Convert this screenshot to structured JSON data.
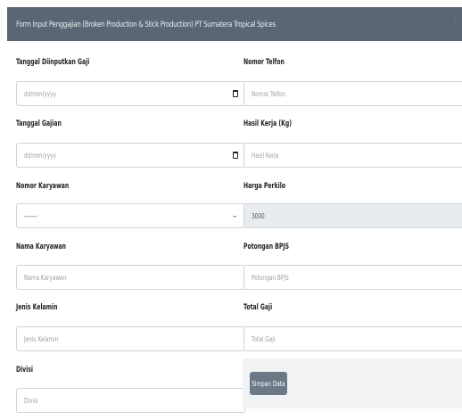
{
  "header": {
    "title": "Form Input Penggajian (Broken Production & Stick Production) PT Sumatera Tropical Spices",
    "tool_icon": "menu-icon"
  },
  "left": {
    "tanggal_diinputkan": {
      "label": "Tanggal Diinputkan Gaji",
      "placeholder": "dd/mm/yyyy"
    },
    "tanggal_gajian": {
      "label": "Tanggal Gajian",
      "placeholder": "dd/mm/yyyy"
    },
    "nomor_karyawan": {
      "label": "Nomor Karyawan",
      "value": "-------"
    },
    "nama_karyawan": {
      "label": "Nama Karyawan",
      "placeholder": "Nama Karyawan"
    },
    "jenis_kelamin": {
      "label": "Jenis Kelamin",
      "placeholder": "Jenis Kelamin"
    },
    "divisi": {
      "label": "Divisi",
      "placeholder": "Divisi"
    }
  },
  "right": {
    "nomor_telfon": {
      "label": "Nomor Telfon",
      "placeholder": "Nomor Telfon"
    },
    "hasil_kerja": {
      "label": "Hasil Kerja (Kg)",
      "placeholder": "Hasil Kerja"
    },
    "harga_perkilo": {
      "label": "Harga Perkilo",
      "value": "3000"
    },
    "potongan_bpjs": {
      "label": "Potongan BPJS",
      "placeholder": "Potongan BPJS"
    },
    "total_gaji": {
      "label": "Total Gaji",
      "placeholder": "Total Gaji"
    }
  },
  "actions": {
    "submit_label": "Simpan Data"
  },
  "colors": {
    "header_bg": "#5a6673",
    "button_bg": "#6b7885",
    "disabled_bg": "#e9ecef"
  }
}
